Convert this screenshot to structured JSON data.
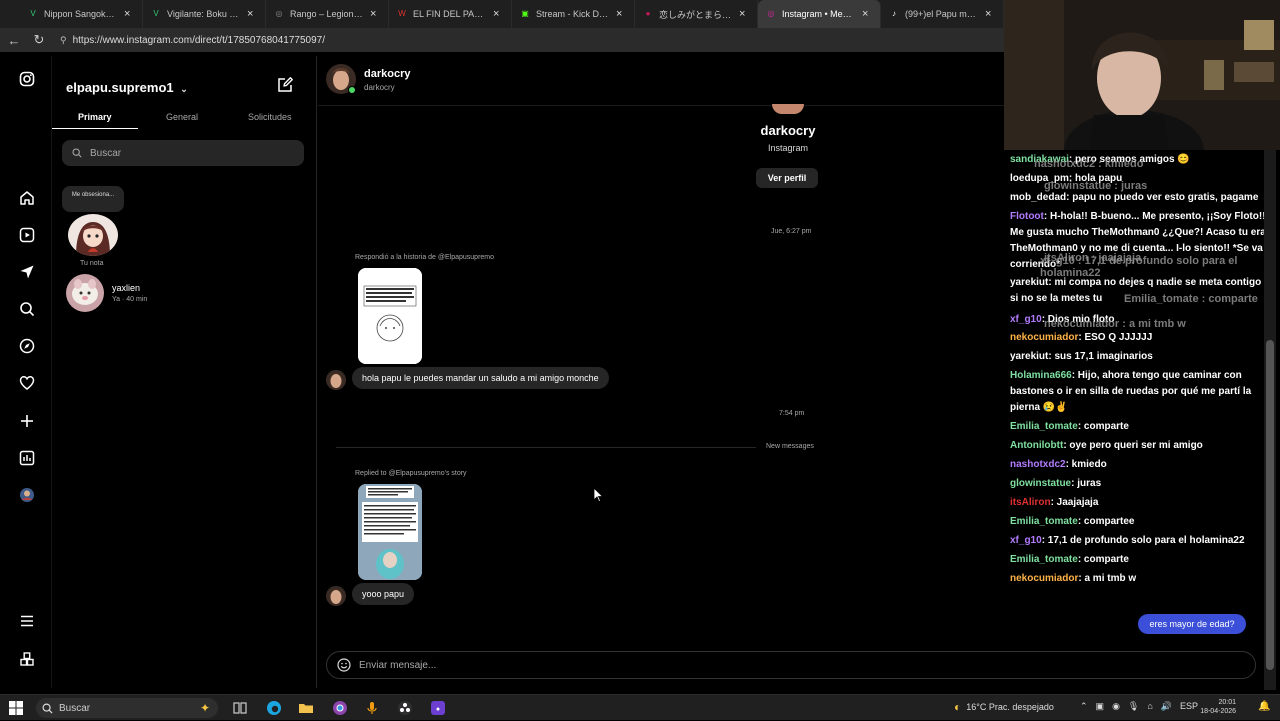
{
  "browser": {
    "tabs": [
      {
        "title": "Nippon Sangoku Episodio",
        "fav_color": "#2ecc71",
        "fav_glyph": "V"
      },
      {
        "title": "Vigilante: Boku no Hero",
        "fav_color": "#2ecc71",
        "fav_glyph": "V"
      },
      {
        "title": "Rango – LegionGames",
        "fav_color": "#888888",
        "fav_glyph": "◎"
      },
      {
        "title": "EL FIN DEL PARAISO – m",
        "fav_color": "#e03131",
        "fav_glyph": "W"
      },
      {
        "title": "Stream - Kick Dashboard",
        "fav_color": "#53fc18",
        "fav_glyph": "▣"
      },
      {
        "title": "恋しみがとまらない | CA",
        "fav_color": "#c2185b",
        "fav_glyph": "●"
      },
      {
        "title": "Instagram • Mensajes",
        "fav_color": "#d6249f",
        "fav_glyph": "◎",
        "active": true
      },
      {
        "title": "(99+)el Papu maximo (@",
        "fav_color": "#ffffff",
        "fav_glyph": "♪"
      }
    ],
    "url": "https://www.instagram.com/direct/t/17850768041775097/"
  },
  "instagram": {
    "account": "elpapu.supremo1",
    "filter_tabs": {
      "primary": "Primary",
      "general": "General",
      "requests": "Solicitudes"
    },
    "search_placeholder": "Buscar",
    "note": {
      "text": "Me obsesiona...",
      "label": "Tu nota"
    },
    "conversations": [
      {
        "name": "yaxlien",
        "sub": "Ya · 40 min"
      }
    ],
    "chat": {
      "name": "darkocry",
      "handle": "darkocry",
      "profile_name": "darkocry",
      "profile_sub": "Instagram",
      "view_profile": "Ver perfil",
      "timestamp_1": "Jue, 6:27 pm",
      "reply_label_1": "Respondió a la historia de @Elpapusupremo",
      "message_1": "hola papu le puedes mandar un saludo a mi amigo monche",
      "timestamp_2": "7:54 pm",
      "new_messages": "New messages",
      "reply_label_2": "Replied to @Elpapusupremo's story",
      "message_2": "yooo papu",
      "composer_placeholder": "Enviar mensaje..."
    }
  },
  "stream_chat": {
    "lines": [
      {
        "user": "sandiakawai",
        "color": "#7fe0a0",
        "text": ": pero seamos amigos 😊"
      },
      {
        "user": "loedupa_pm",
        "color": "#ffffff",
        "text": ": hola papu"
      },
      {
        "user": "mob_dedad",
        "color": "#ffffff",
        "text": ": papu no puedo ver esto gratis, pagame"
      },
      {
        "user": "Flotoot",
        "color": "#b37bff",
        "text": ": H-hola!! B-bueno... Me presento, ¡¡Soy Floto!! Me gusta mucho TheMothman0 ¿¿Que?! Acaso tu eras TheMothman0 y no me di cuenta... I-lo siento!! *Se va corriendo*"
      },
      {
        "user": "yarekiut",
        "color": "#ffffff",
        "text": ": mi compa no dejes q nadie se meta contigo pq si no se la metes tu"
      },
      {
        "user": "xf_g10",
        "color": "#b37bff",
        "text": ": Dios mio floto"
      },
      {
        "user": "nekocumiador",
        "color": "#ffb347",
        "text": ": ESO Q JJJJJJ"
      },
      {
        "user": "yarekiut",
        "color": "#ffffff",
        "text": ": sus 17,1 imaginarios"
      },
      {
        "user": "Holamina666",
        "color": "#7fe0a0",
        "text": ": Hijo, ahora tengo que caminar con bastones o ir en silla de ruedas por qué me partí la pierna 😢✌"
      },
      {
        "user": "Emilia_tomate",
        "color": "#7fe0a0",
        "text": ": comparte"
      },
      {
        "user": "Antonilobtt",
        "color": "#7fe0a0",
        "text": ": oye pero queri ser mi amigo"
      },
      {
        "user": "nashotxdc2",
        "color": "#b37bff",
        "text": ": kmiedo"
      },
      {
        "user": "glowinstatue",
        "color": "#7fe0a0",
        "text": ": juras"
      },
      {
        "user": "itsAliron",
        "color": "#e03131",
        "text": ": Jaajajaja"
      },
      {
        "user": "Emilia_tomate",
        "color": "#7fe0a0",
        "text": ": compartee"
      },
      {
        "user": "xf_g10",
        "color": "#b37bff",
        "text": ": 17,1 de profundo solo para el holamina22"
      },
      {
        "user": "Emilia_tomate",
        "color": "#7fe0a0",
        "text": ": comparte"
      },
      {
        "user": "nekocumiador",
        "color": "#ffb347",
        "text": ": a mi tmb w"
      }
    ],
    "ghosts": [
      {
        "text": "nashotxdc2 : kmiedo"
      },
      {
        "text": "glowinstatue : juras"
      },
      {
        "text": "itsAliron : jaajajaja"
      },
      {
        "text": "xf_g10 : 17,1 de profundo solo para el holamina22"
      },
      {
        "text": "Emilia_tomate : comparte"
      },
      {
        "text": "nekocumiador : a mi tmb w"
      }
    ],
    "button": "eres mayor de edad?"
  },
  "taskbar": {
    "search": "Buscar",
    "weather": "16°C  Prac. despejado",
    "tray": "ESP",
    "time": "20:01",
    "date": "18-04-2026"
  }
}
